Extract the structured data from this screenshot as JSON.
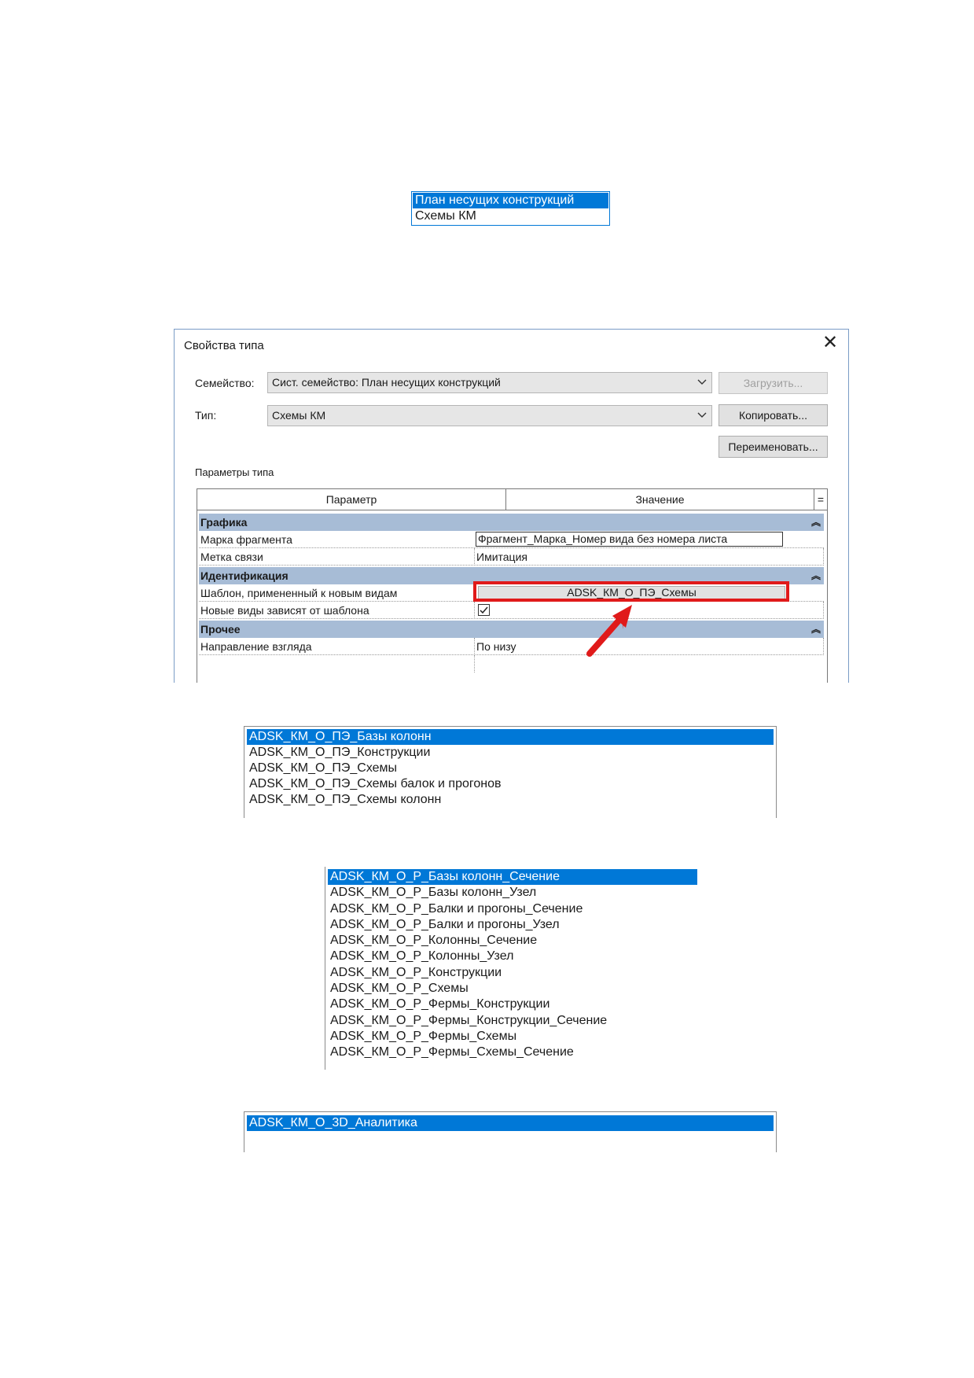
{
  "list_view_types": {
    "items": [
      {
        "label": "План несущих конструкций",
        "selected": true
      },
      {
        "label": "Схемы КМ",
        "selected": false
      }
    ]
  },
  "dialog": {
    "title": "Свойства типа",
    "family_label": "Семейство:",
    "family_value": "Сист. семейство: План несущих конструкций",
    "type_label": "Тип:",
    "type_value": "Схемы КМ",
    "load_button": "Загрузить...",
    "copy_button": "Копировать...",
    "rename_button": "Переименовать...",
    "params_label": "Параметры типа",
    "grid": {
      "col_param": "Параметр",
      "col_value": "Значение",
      "col_extra": "=",
      "groups": [
        {
          "name": "Графика",
          "rows": [
            {
              "param": "Марка фрагмента",
              "value": "Фрагмент_Марка_Номер вида без номера листа"
            },
            {
              "param": "Метка связи",
              "value": "Имитация"
            }
          ]
        },
        {
          "name": "Идентификация",
          "rows": [
            {
              "param": "Шаблон, примененный к новым видам",
              "value": "ADSK_КМ_О_ПЭ_Схемы"
            },
            {
              "param": "Новые виды зависят от шаблона",
              "value": "checked"
            }
          ]
        },
        {
          "name": "Прочее",
          "rows": [
            {
              "param": "Направление взгляда",
              "value": "По низу"
            }
          ]
        }
      ],
      "collapse_glyph": "»"
    },
    "colors": {
      "highlight": "#e01a1a",
      "group_bg": "#a7bcd6",
      "selection": "#0078d7"
    }
  },
  "list_templates_pe": {
    "items": [
      {
        "label": "ADSK_КМ_О_ПЭ_Базы колонн",
        "selected": true
      },
      {
        "label": "ADSK_КМ_О_ПЭ_Конструкции",
        "selected": false
      },
      {
        "label": "ADSK_КМ_О_ПЭ_Схемы",
        "selected": false
      },
      {
        "label": "ADSK_КМ_О_ПЭ_Схемы балок и прогонов",
        "selected": false
      },
      {
        "label": "ADSK_КМ_О_ПЭ_Схемы колонн",
        "selected": false
      }
    ]
  },
  "list_templates_r": {
    "items": [
      {
        "label": "ADSK_КМ_О_Р_Базы колонн_Сечение",
        "selected": true
      },
      {
        "label": "ADSK_КМ_О_Р_Базы колонн_Узел",
        "selected": false
      },
      {
        "label": "ADSK_КМ_О_Р_Балки и прогоны_Сечение",
        "selected": false
      },
      {
        "label": "ADSK_КМ_О_Р_Балки и прогоны_Узел",
        "selected": false
      },
      {
        "label": "ADSK_КМ_О_Р_Колонны_Сечение",
        "selected": false
      },
      {
        "label": "ADSK_КМ_О_Р_Колонны_Узел",
        "selected": false
      },
      {
        "label": "ADSK_КМ_О_Р_Конструкции",
        "selected": false
      },
      {
        "label": "ADSK_КМ_О_Р_Схемы",
        "selected": false
      },
      {
        "label": "ADSK_КМ_О_Р_Фермы_Конструкции",
        "selected": false
      },
      {
        "label": "ADSK_КМ_О_Р_Фермы_Конструкции_Сечение",
        "selected": false
      },
      {
        "label": "ADSK_КМ_О_Р_Фермы_Схемы",
        "selected": false
      },
      {
        "label": "ADSK_КМ_О_Р_Фермы_Схемы_Сечение",
        "selected": false
      }
    ]
  },
  "list_templates_3d": {
    "items": [
      {
        "label": "ADSK_КМ_О_3D_Аналитика",
        "selected": true
      }
    ]
  }
}
